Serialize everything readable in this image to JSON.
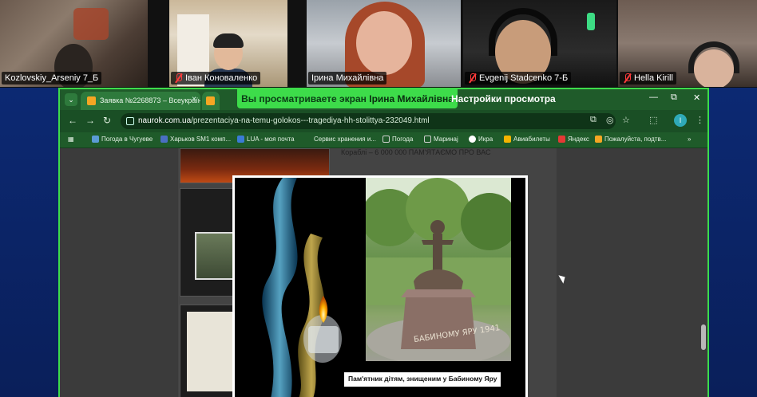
{
  "participants": [
    {
      "name": "Kozlovskiy_Arseniy 7_Б",
      "muted": false
    },
    {
      "name": "Іван Коноваленко",
      "muted": true
    },
    {
      "name": "Ірина Михайлівна",
      "muted": false,
      "speaking": false
    },
    {
      "name": "Evgenij Stadcenko 7-Б",
      "muted": true
    },
    {
      "name": "Hella Kirill",
      "muted": true
    }
  ],
  "share_banner": {
    "prefix": "Вы просматриваете экран",
    "presenter": "Ірина Михайлівна",
    "settings_label": "Настройки просмотра"
  },
  "browser": {
    "tabs": [
      {
        "title": "Заявка №2268873 – Всеукраїн...",
        "close": "×"
      },
      {
        "title": "",
        "close": ""
      }
    ],
    "url_host": "naurok.com.ua",
    "url_path": "/prezentaciya-na-temu-golokos---tragediya-hh-stolittya-232049.html",
    "profile_initial": "I",
    "window_controls": {
      "minimize": "—",
      "maximize": "⧉",
      "close": "✕"
    },
    "nav": {
      "back": "←",
      "forward": "→",
      "reload": "↻"
    },
    "bookmarks": [
      {
        "label": "Погода в Чугуеве",
        "color": "#5b9bd5"
      },
      {
        "label": "Харьков SM1 комп...",
        "color": "#4a6fc2"
      },
      {
        "label": "LUA - моя почта",
        "color": "#3a7bd5"
      },
      {
        "label": "Сервис хранения и...",
        "color": ""
      },
      {
        "label": "Погода",
        "color": "#cfcfcf"
      },
      {
        "label": "Маринај",
        "color": "#cfcfcf"
      },
      {
        "label": "Икра",
        "color": "#ffffff"
      },
      {
        "label": "Авиабилеты",
        "color": "#f5b400"
      },
      {
        "label": "Яндекс",
        "color": "#e53935"
      },
      {
        "label": "Пожалуйста, подтв...",
        "color": "#f5a623"
      }
    ],
    "bookmarks_more": "»"
  },
  "page": {
    "partial_text": "Кораблі – 6 000 000 ПАМ'ЯТАЄМО ПРО ВАС",
    "slide_caption": "Пам'ятник дітям, знищеним у Бабиному Яру",
    "monument_inscription": "БАБИНОМУ ЯРУ 1941"
  },
  "colors": {
    "share_accent": "#3ddc4a",
    "browser_frame": "#1f5b2a",
    "background": "#0d2c7a"
  }
}
